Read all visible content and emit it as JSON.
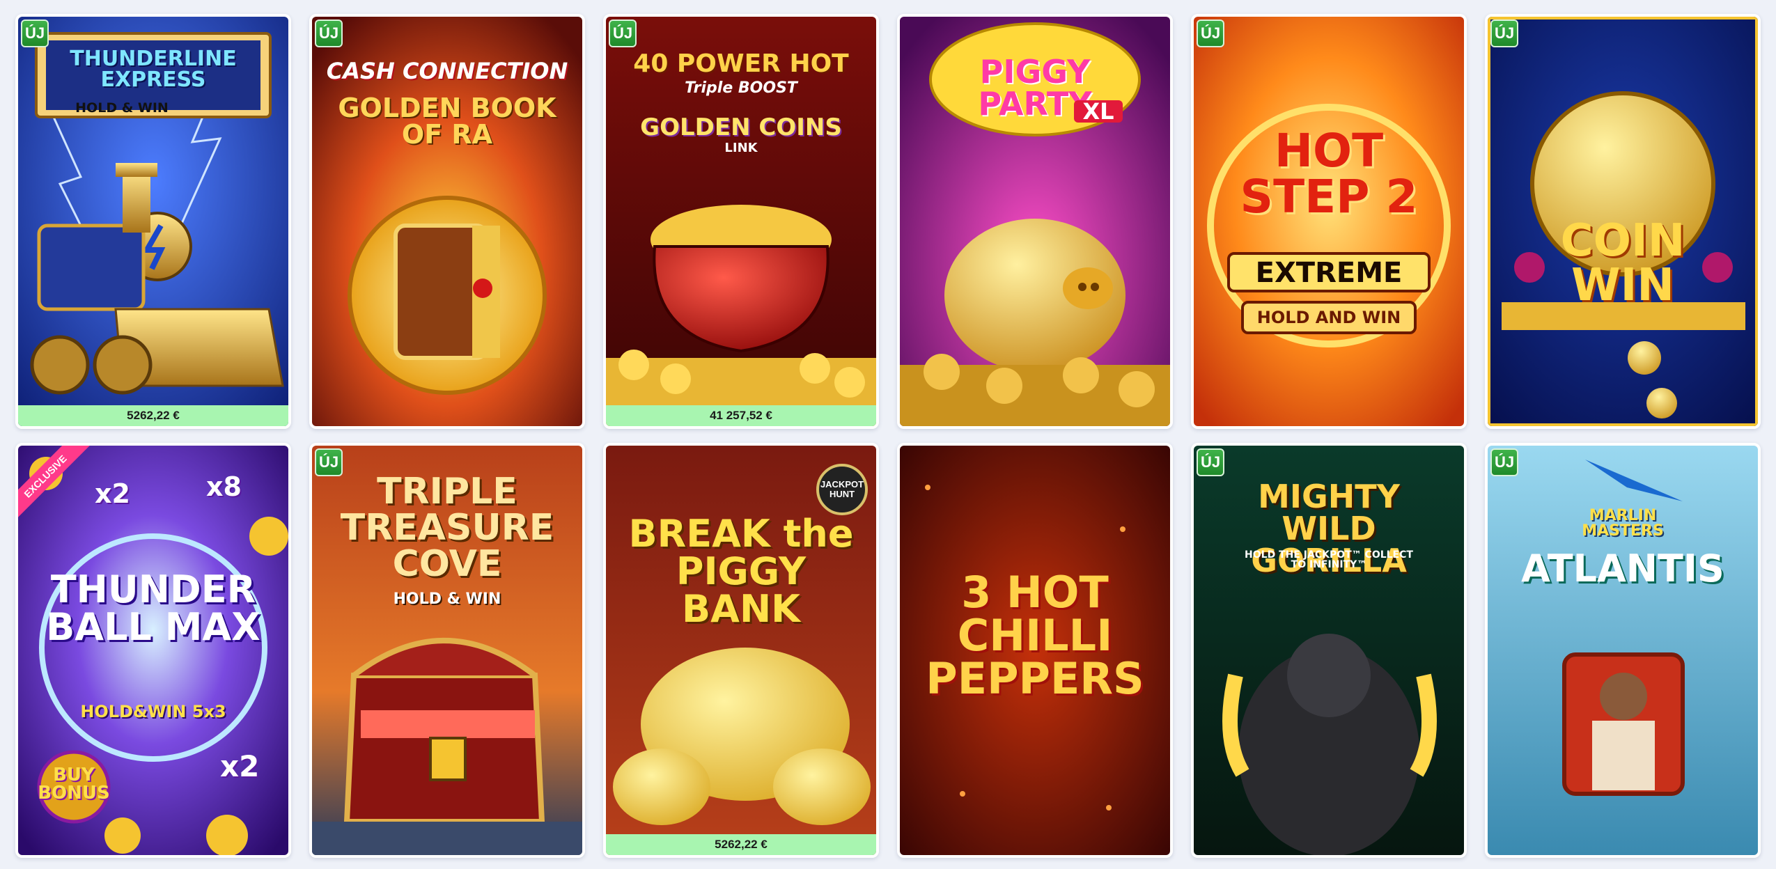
{
  "new_badge_label": "ÚJ",
  "games": [
    {
      "name": "THUNDERLINE EXPRESS",
      "subtitle": "HOLD & WIN",
      "jackpot": "5262,22 €",
      "is_new": true
    },
    {
      "name": "CASH CONNECTION",
      "subtitle": "GOLDEN BOOK OF RA",
      "is_new": true
    },
    {
      "name": "40 POWER HOT",
      "subtitle": "Triple BOOST",
      "extra": "GOLDEN COINS",
      "link": "LINK",
      "jackpot": "41 257,52 €",
      "is_new": true
    },
    {
      "name": "PIGGY PARTY",
      "subtitle": "XL",
      "is_new": false
    },
    {
      "name": "HOT STEP 2",
      "subtitle": "EXTREME",
      "extra": "HOLD AND WIN",
      "is_new": true
    },
    {
      "name": "COIN WIN",
      "is_new": true
    },
    {
      "name": "THUNDER BALL MAX",
      "subtitle": "HOLD&WIN 5x3",
      "extra": "BUY BONUS",
      "ribbon": "EXCLUSIVE",
      "mult_a": "x2",
      "mult_b": "x8",
      "mult_c": "x2",
      "is_new": false
    },
    {
      "name": "TRIPLE TREASURE COVE",
      "subtitle": "HOLD & WIN",
      "is_new": true
    },
    {
      "name": "BREAK the PIGGY BANK",
      "seal": "JACKPOT HUNT",
      "jackpot": "5262,22 €",
      "is_new": false
    },
    {
      "name": "3 HOT CHILLI PEPPERS",
      "is_new": false
    },
    {
      "name": "MIGHTY WILD GORILLA",
      "subtitle": "HOLD THE JACKPOT™ COLLECT TO INFINITY™",
      "is_new": true
    },
    {
      "name": "ATLANTIS",
      "subtitle": "MARLIN MASTERS",
      "is_new": true
    }
  ]
}
